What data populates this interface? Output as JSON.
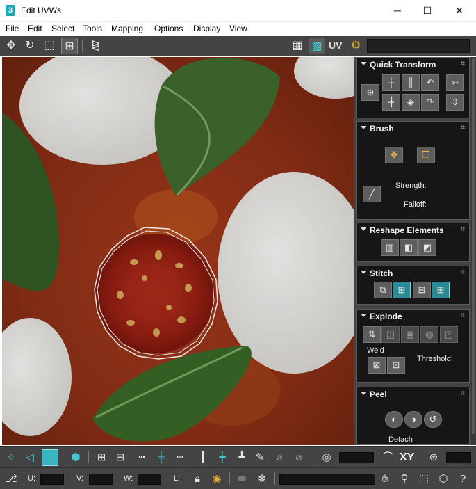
{
  "window": {
    "app_icon": "3",
    "title": "Edit UVWs",
    "minimize": "─",
    "maximize": "☐",
    "close": "✕"
  },
  "menu": [
    "File",
    "Edit",
    "Select",
    "Tools",
    "Mapping",
    "Options",
    "Display",
    "View"
  ],
  "toolbar_top": {
    "uv_label": "UV",
    "icons": [
      "move-icon",
      "rotate-icon",
      "scale-icon",
      "freeform-icon",
      "mirror-icon",
      "checker-pattern-icon",
      "checker-map-icon",
      "settings-map-icon"
    ]
  },
  "panel": {
    "quick_transform": {
      "title": "Quick Transform"
    },
    "brush": {
      "title": "Brush",
      "strength_label": "Strength:",
      "falloff_label": "Falloff:"
    },
    "reshape": {
      "title": "Reshape Elements"
    },
    "stitch": {
      "title": "Stitch"
    },
    "explode": {
      "title": "Explode",
      "weld_label": "Weld",
      "threshold_label": "Threshold:"
    },
    "peel": {
      "title": "Peel",
      "detach_label": "Detach"
    }
  },
  "toolbar_bottom1": {
    "xy_label": "XY",
    "icons": [
      "vertex-select-icon",
      "edge-select-icon",
      "face-select-icon",
      "element-select-icon",
      "grow-select-icon",
      "shrink-select-icon",
      "loop-icon",
      "ring-icon",
      "soft-select-icon",
      "paint-select-icon",
      "rotate-uv-icon",
      "xy-axis-icon"
    ]
  },
  "toolbar_bottom2": {
    "u_label": "U:",
    "v_label": "V:",
    "w_label": "W:",
    "l_label": "L:",
    "icons": [
      "absolute-offset-icon",
      "lock-icon",
      "hide-icon",
      "freeze-icon",
      "pan-icon",
      "zoom-icon",
      "zoom-region-icon",
      "zoom-extents-icon",
      "help-icon"
    ]
  },
  "colors": {
    "accent_teal": "#2c8a94",
    "panel_bg": "#444444",
    "rollout_bg": "#161616"
  }
}
